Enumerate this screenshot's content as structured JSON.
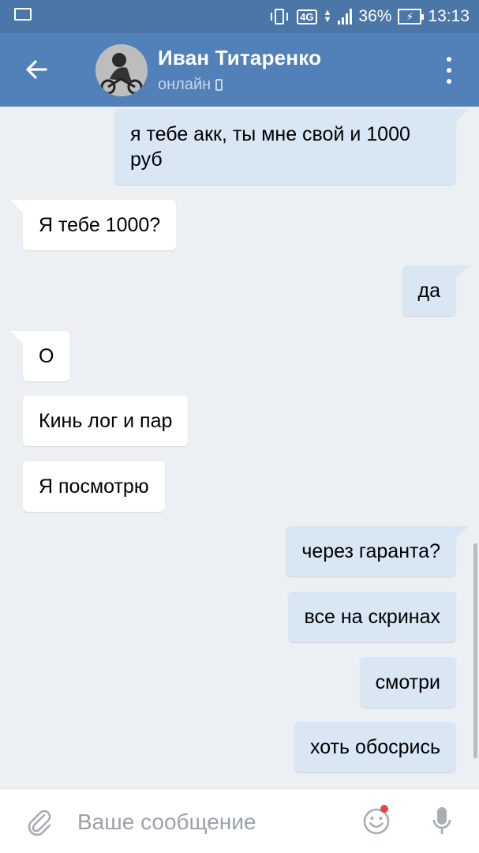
{
  "status_bar": {
    "network": "4G",
    "battery": "36%",
    "time": "13:13"
  },
  "header": {
    "contact_name": "Иван Титаренко",
    "contact_status": "онлайн"
  },
  "messages": [
    {
      "direction": "out",
      "text": "я тебе акк, ты мне свой и 1000 руб"
    },
    {
      "direction": "in",
      "text": "Я тебе 1000?"
    },
    {
      "direction": "out",
      "text": "да"
    },
    {
      "direction": "in",
      "text": "О"
    },
    {
      "direction": "in",
      "text": "Кинь лог и пар"
    },
    {
      "direction": "in",
      "text": "Я посмотрю"
    },
    {
      "direction": "out",
      "text": "через гаранта?"
    },
    {
      "direction": "out",
      "text": "все на скринах"
    },
    {
      "direction": "out",
      "text": "смотри"
    },
    {
      "direction": "out",
      "text": "хоть обосрись"
    }
  ],
  "composer": {
    "placeholder": "Ваше сообщение"
  },
  "colors": {
    "header": "#5181b8",
    "status_bar": "#4a76a8",
    "outgoing_bubble": "#d9e6f4",
    "incoming_bubble": "#ffffff",
    "background": "#edf0f2"
  }
}
